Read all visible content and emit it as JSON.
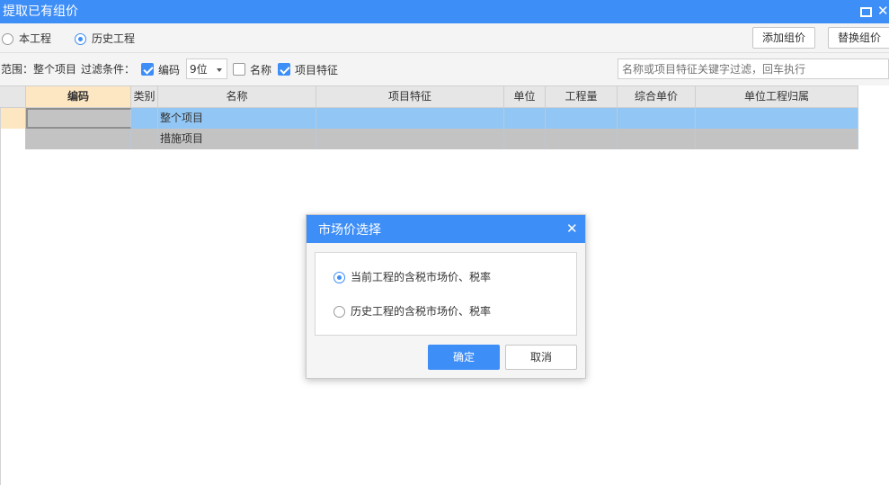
{
  "window": {
    "title": "提取已有组价"
  },
  "scope_tabs": [
    {
      "label": "本工程",
      "selected": false
    },
    {
      "label": "历史工程",
      "selected": true
    }
  ],
  "toolbar": {
    "add_label": "添加组价",
    "replace_label": "替换组价"
  },
  "filter": {
    "scope_text": "范围：整个项目",
    "condition_text": "过滤条件：",
    "code": {
      "label": "编码",
      "checked": true
    },
    "digits": {
      "value": "9位"
    },
    "name": {
      "label": "名称",
      "checked": false
    },
    "feature": {
      "label": "项目特征",
      "checked": true
    },
    "search_placeholder": "名称或项目特征关键字过滤，回车执行"
  },
  "grid": {
    "columns": [
      "编码",
      "类别",
      "名称",
      "项目特征",
      "单位",
      "工程量",
      "综合单价",
      "单位工程归属"
    ],
    "rows": [
      {
        "code": "",
        "type": "",
        "name": "整个项目",
        "feature": "",
        "unit": "",
        "qty": "",
        "price": "",
        "owner": ""
      },
      {
        "code": "",
        "type": "",
        "name": "措施项目",
        "feature": "",
        "unit": "",
        "qty": "",
        "price": "",
        "owner": ""
      }
    ]
  },
  "dialog": {
    "title": "市场价选择",
    "options": [
      {
        "label": "当前工程的含税市场价、税率",
        "selected": true
      },
      {
        "label": "历史工程的含税市场价、税率",
        "selected": false
      }
    ],
    "ok_label": "确定",
    "cancel_label": "取消"
  },
  "colors": {
    "accent": "#3e8ef7",
    "selected_row": "#92c7f5",
    "header_code": "#fde6c2",
    "gray_row": "#c3c3c3"
  }
}
